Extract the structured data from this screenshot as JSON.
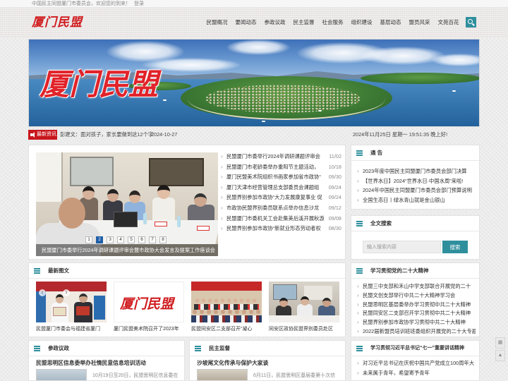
{
  "colors": {
    "accent": "#2f8f9d",
    "brand_red": "#c8161d",
    "text": "#333333",
    "muted": "#888888"
  },
  "topbar": {
    "welcome": "中国民主同盟厦门市委员会，欢迎您的到来！",
    "login": "登录"
  },
  "header": {
    "logo_text": "厦门民盟",
    "nav": [
      "民盟概况",
      "要闻动态",
      "参政议政",
      "民主监督",
      "社会服务",
      "组织建设",
      "基层动态",
      "盟员风采",
      "文苑百花"
    ],
    "search_icon": "search-icon"
  },
  "ticker": {
    "label": "最新资讯",
    "icon": "speaker-icon",
    "headline": "彭建文：面对孩子，家长要做到这12个字",
    "date": "2024-10-27",
    "clock": "2024年11月25日 星期一 19:51:35 晚上好!"
  },
  "slider": {
    "caption": "民盟厦门市委举行2024年调研课题评审会暨市政协大会发言及提案工作座谈会",
    "pages": [
      "1",
      "2",
      "3",
      "4",
      "5",
      "6",
      "7",
      "8"
    ],
    "active_page": "2"
  },
  "top_news": [
    {
      "title": "民盟厦门市委举行2024年调研课题评审会",
      "date": "11/02"
    },
    {
      "title": "民盟厦门市老龄委举办重阳节主题活动，",
      "date": "10/18"
    },
    {
      "title": "厦门民盟美术院组织书画家参加省市政协“",
      "date": "09/30"
    },
    {
      "title": "厦门天津市经营管理总支部委员会课题组",
      "date": "09/24"
    },
    {
      "title": "民盟界别参加市政协“大力发展康复事业 促",
      "date": "09/24"
    },
    {
      "title": "市政协民盟界别委员联系点举办信息沙龙",
      "date": "09/12"
    },
    {
      "title": "民盟厦门市委机关工会赴集美后溪开展秋游活动",
      "date": "09/08"
    },
    {
      "title": "民盟界别参加市政协“新就业形态劳动者权",
      "date": "08/30"
    }
  ],
  "notice": {
    "title": "通 告",
    "items": [
      "2023年度中国民主同盟厦门市委员会部门决算",
      "【世界水日】2024“世界水日·中国水周”来啦!",
      "2024年中国民主同盟厦门市委员会部门预算说明",
      "全国生态日丨绿水青山就是金山银山"
    ]
  },
  "search": {
    "title": "全文搜索",
    "placeholder": "输入搜索内容",
    "button": "搜索"
  },
  "photo_news": {
    "title": "最新图文",
    "items": [
      {
        "caption": "民盟厦门市委会与福建省厦门"
      },
      {
        "caption": "厦门民盟美术院召开了2023年"
      },
      {
        "caption": "民盟同安区二支部召开“凝心"
      },
      {
        "caption": "同安区政协民盟界别委员赴区"
      }
    ]
  },
  "study_20th": {
    "title": "学习贯彻党的二十大精神",
    "items": [
      "民盟三中支部和禾山中学支部联合开展党的二十",
      "民盟文创支部举行中共二十大精神学习会",
      "民盟思明区基层委举办学习贯彻中共二十大精神",
      "民盟同安区二支部召开学习贯彻中共二十大精神",
      "民盟界别参加市政协学习贯彻中共二十大精神",
      "2022届新盟员培训班班委组织开展党的二十大专题"
    ]
  },
  "politics": {
    "title": "参政议政",
    "headline": "民盟思明区信息委举办社情民意信息培训活动",
    "summary": "10月19日至20日，民盟思明区信息委在"
  },
  "supervision": {
    "title": "民主监督",
    "headline": "沙坡尾文化传承与保护大家谈",
    "summary": "6月11日，民盟思明区基层委第十次信"
  },
  "study_71": {
    "title": "学习贯彻习近平总书记“七一”重要讲话精神",
    "items": [
      "对习近平总书记在庆祝中国共产党成立100周年大",
      "未来属于青年，希望寄予青年"
    ]
  }
}
